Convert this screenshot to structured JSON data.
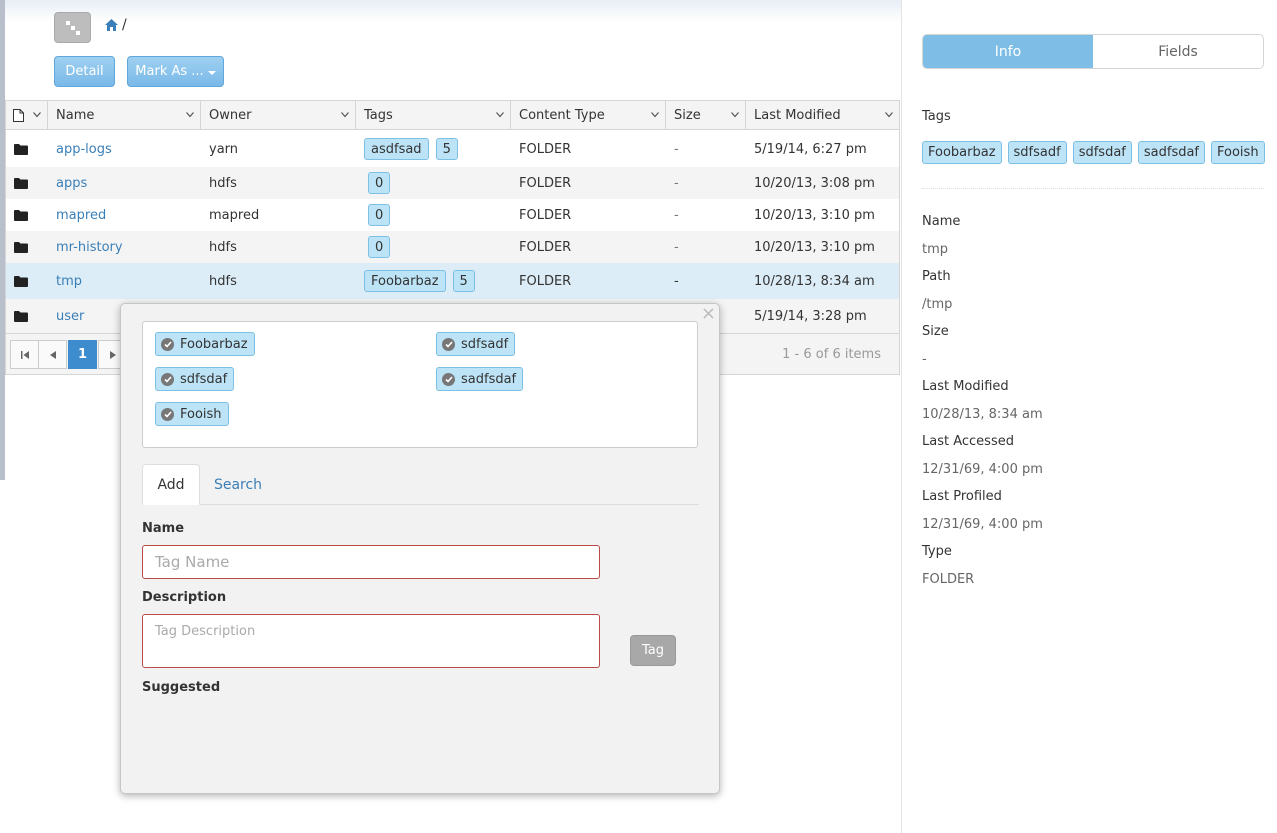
{
  "breadcrumb": {
    "separator": "/"
  },
  "toolbar": {
    "detail_label": "Detail",
    "mark_as_label": "Mark As ..."
  },
  "grid": {
    "columns": [
      "Name",
      "Owner",
      "Tags",
      "Content Type",
      "Size",
      "Last Modified"
    ],
    "rows": [
      {
        "name": "app-logs",
        "owner": "yarn",
        "tags": [
          "asdfsad",
          "5"
        ],
        "type": "FOLDER",
        "size": "-",
        "modified": "5/19/14, 6:27 pm"
      },
      {
        "name": "apps",
        "owner": "hdfs",
        "tags": [
          "0"
        ],
        "type": "FOLDER",
        "size": "-",
        "modified": "10/20/13, 3:08 pm"
      },
      {
        "name": "mapred",
        "owner": "mapred",
        "tags": [
          "0"
        ],
        "type": "FOLDER",
        "size": "-",
        "modified": "10/20/13, 3:10 pm"
      },
      {
        "name": "mr-history",
        "owner": "hdfs",
        "tags": [
          "0"
        ],
        "type": "FOLDER",
        "size": "-",
        "modified": "10/20/13, 3:10 pm"
      },
      {
        "name": "tmp",
        "owner": "hdfs",
        "tags": [
          "Foobarbaz",
          "5"
        ],
        "type": "FOLDER",
        "size": "-",
        "modified": "10/28/13, 8:34 am"
      },
      {
        "name": "user",
        "owner": "",
        "tags": [],
        "type": "",
        "size": "",
        "modified": "5/19/14, 3:28 pm"
      }
    ],
    "pager": {
      "current_page": "1",
      "info": "1 - 6 of 6 items"
    }
  },
  "popover": {
    "close": "×",
    "tags": [
      "Foobarbaz",
      "sdfsadf",
      "sdfsdaf",
      "sadfsdaf",
      "Fooish"
    ],
    "tabs": {
      "add": "Add",
      "search": "Search"
    },
    "name_label": "Name",
    "name_placeholder": "Tag Name",
    "description_label": "Description",
    "description_placeholder": "Tag Description",
    "tag_button": "Tag",
    "suggested_label": "Suggested"
  },
  "panel": {
    "tabs": {
      "info": "Info",
      "fields": "Fields"
    },
    "tags_label": "Tags",
    "tags": [
      "Foobarbaz",
      "sdfsadf",
      "sdfsdaf",
      "sadfsdaf",
      "Fooish"
    ],
    "fields": [
      {
        "label": "Name",
        "value": "tmp"
      },
      {
        "label": "Path",
        "value": "/tmp"
      },
      {
        "label": "Size",
        "value": "-"
      },
      {
        "label": "Last Modified",
        "value": "10/28/13, 8:34 am"
      },
      {
        "label": "Last Accessed",
        "value": "12/31/69, 4:00 pm"
      },
      {
        "label": "Last Profiled",
        "value": "12/31/69, 4:00 pm"
      },
      {
        "label": "Type",
        "value": "FOLDER"
      }
    ]
  },
  "colors": {
    "accent": "#7ebde6",
    "link": "#3a7fb8",
    "tag_bg": "#bde3f6",
    "error_border": "#b94a48"
  },
  "icons": {
    "tree": "tree-icon",
    "home": "home-icon",
    "file": "file-icon",
    "folder": "folder-icon"
  }
}
